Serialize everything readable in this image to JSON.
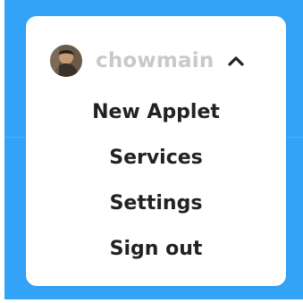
{
  "colors": {
    "backdrop": "#33a3f7",
    "card": "#ffffff",
    "username": "#c9c9c9",
    "menu_text": "#222222"
  },
  "user": {
    "username": "chowmain",
    "avatar_icon": "avatar-photo",
    "toggle_icon": "chevron-up-icon"
  },
  "menu": {
    "items": [
      {
        "label": "New Applet"
      },
      {
        "label": "Services"
      },
      {
        "label": "Settings"
      },
      {
        "label": "Sign out"
      }
    ]
  }
}
